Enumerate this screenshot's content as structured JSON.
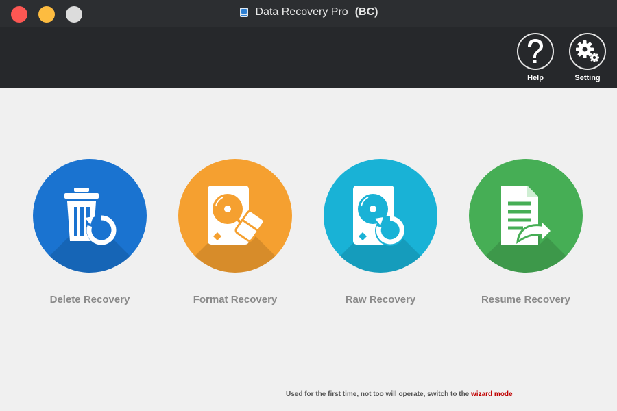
{
  "window": {
    "title": "Data Recovery Pro",
    "edition": "(BC)"
  },
  "toolbar": {
    "help_label": "Help",
    "setting_label": "Setting"
  },
  "modes": [
    {
      "label": "Delete Recovery",
      "color": "#1a73d0",
      "icon": "trash-restore-icon"
    },
    {
      "label": "Format Recovery",
      "color": "#f5a030",
      "icon": "hdd-eraser-icon"
    },
    {
      "label": "Raw Recovery",
      "color": "#19b2d6",
      "icon": "hdd-restore-icon"
    },
    {
      "label": "Resume Recovery",
      "color": "#46ae55",
      "icon": "document-restore-icon"
    }
  ],
  "footer": {
    "hint_text": "Used for the first time, not too will operate, switch to the ",
    "wizard_link": "wizard mode",
    "link_color": "#c00000"
  }
}
